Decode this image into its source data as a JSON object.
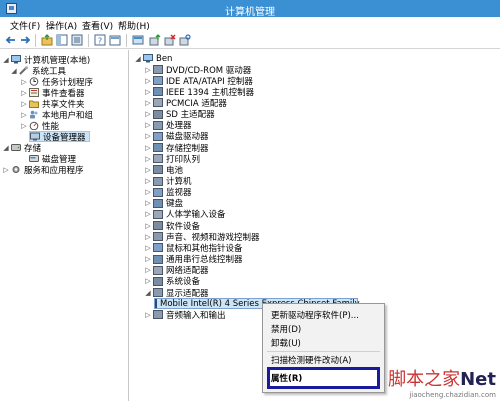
{
  "window": {
    "title": "计算机管理"
  },
  "menubar": [
    "文件(F)",
    "操作(A)",
    "查看(V)",
    "帮助(H)"
  ],
  "left_tree": [
    {
      "label": "计算机管理(本地)",
      "indent": 0,
      "expander": "▲",
      "icon": "computer-icon"
    },
    {
      "label": "系统工具",
      "indent": 1,
      "expander": "◢",
      "icon": "tools-icon"
    },
    {
      "label": "任务计划程序",
      "indent": 2,
      "expander": "▷",
      "icon": "clock-icon"
    },
    {
      "label": "事件查看器",
      "indent": 2,
      "expander": "▷",
      "icon": "event-icon"
    },
    {
      "label": "共享文件夹",
      "indent": 2,
      "expander": "▷",
      "icon": "folder-icon"
    },
    {
      "label": "本地用户和组",
      "indent": 2,
      "expander": "▷",
      "icon": "users-icon"
    },
    {
      "label": "性能",
      "indent": 2,
      "expander": "▷",
      "icon": "performance-icon"
    },
    {
      "label": "设备管理器",
      "indent": 2,
      "expander": "",
      "icon": "device-manager-icon",
      "selected": true
    },
    {
      "label": "存储",
      "indent": 0,
      "expander": "◢",
      "icon": "storage-icon"
    },
    {
      "label": "磁盘管理",
      "indent": 2,
      "expander": "",
      "icon": "disk-icon"
    },
    {
      "label": "服务和应用程序",
      "indent": 0,
      "expander": "▷",
      "icon": "services-icon"
    }
  ],
  "device_tree": {
    "root": "Ben",
    "items": [
      "DVD/CD-ROM 驱动器",
      "IDE ATA/ATAPI 控制器",
      "IEEE 1394 主机控制器",
      "PCMCIA 适配器",
      "SD 主适配器",
      "处理器",
      "磁盘驱动器",
      "存储控制器",
      "打印队列",
      "电池",
      "计算机",
      "监视器",
      "键盘",
      "人体学输入设备",
      "软件设备",
      "声音、视频和游戏控制器",
      "鼠标和其他指针设备",
      "通用串行总线控制器",
      "网络适配器",
      "系统设备",
      "显示适配器"
    ],
    "expanded_child": "Mobile Intel(R) 4 Series Express Chipset Family",
    "after_item": "音频输入和输出"
  },
  "context_menu": {
    "items": [
      "更新驱动程序软件(P)...",
      "禁用(D)",
      "卸载(U)",
      "扫描检测硬件改动(A)",
      "属性(R)"
    ],
    "highlighted": "属性(R)"
  },
  "watermark": {
    "main": "脚本之家",
    "net": "Net",
    "sub": "jiaocheng.chazidian.com"
  },
  "colors": {
    "titlebar": "#3b8fd3",
    "selection": "#cce4f7",
    "highlight_border": "#1a1a9c",
    "watermark": "#cc3333"
  }
}
